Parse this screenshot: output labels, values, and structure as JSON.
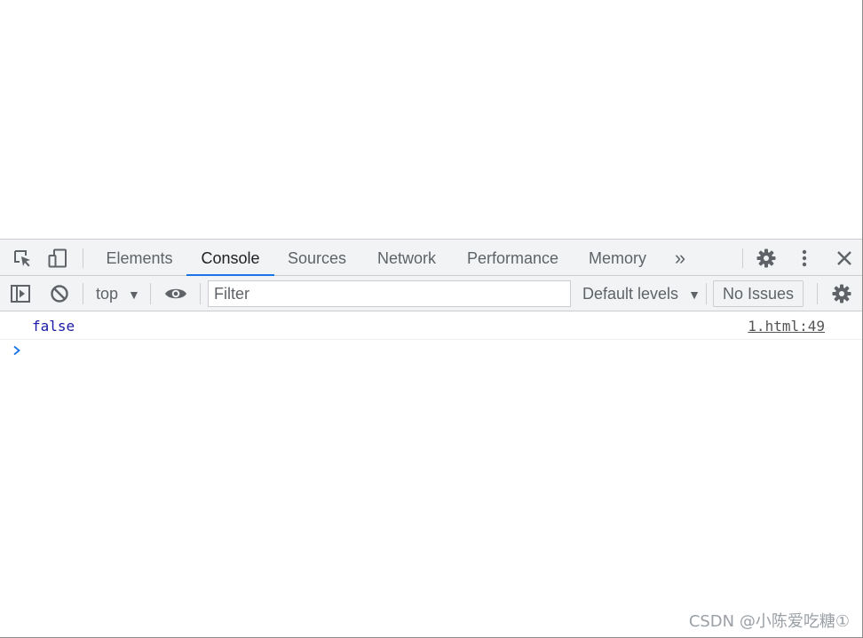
{
  "devtools": {
    "tabs": [
      {
        "label": "Elements"
      },
      {
        "label": "Console"
      },
      {
        "label": "Sources"
      },
      {
        "label": "Network"
      },
      {
        "label": "Performance"
      },
      {
        "label": "Memory"
      }
    ],
    "active_tab": "Console",
    "more_tabs_glyph": "»",
    "accent_color": "#1a73e8"
  },
  "console_toolbar": {
    "context": "top",
    "filter_placeholder": "Filter",
    "levels": "Default levels",
    "issues": "No Issues"
  },
  "console": {
    "messages": [
      {
        "text": "false",
        "source": "1.html:49"
      }
    ],
    "prompt_glyph": "›"
  },
  "watermark": "CSDN @小陈爱吃糖①"
}
